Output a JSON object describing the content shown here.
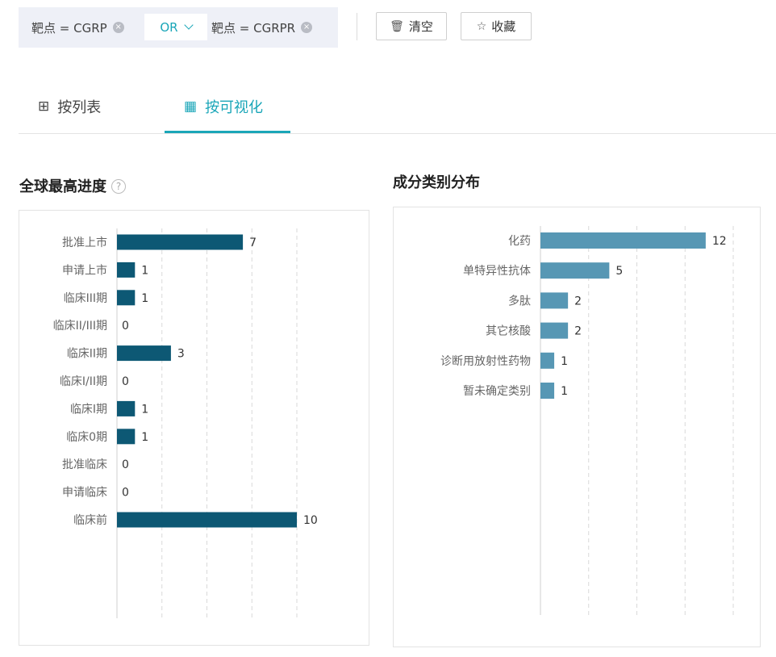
{
  "filters": {
    "chip1": "靶点 = CGRP",
    "operator": "OR",
    "chip2": "靶点 = CGRPR",
    "close_glyph": "×"
  },
  "toolbar": {
    "clear_label": "清空",
    "collect_label": "收藏"
  },
  "tabs": {
    "list_label": "按列表",
    "visual_label": "按可视化",
    "active": "visual"
  },
  "sections": {
    "progress_title": "全球最高进度",
    "help_glyph": "?",
    "category_title": "成分类别分布"
  },
  "colors": {
    "accent": "#1aa6b8",
    "bar_dark": "#0d5874",
    "bar_light": "#5797b4"
  },
  "chart_data": [
    {
      "type": "bar",
      "orientation": "horizontal",
      "categories": [
        "批准上市",
        "申请上市",
        "临床III期",
        "临床II/III期",
        "临床II期",
        "临床I/II期",
        "临床I期",
        "临床0期",
        "批准临床",
        "申请临床",
        "临床前"
      ],
      "values": [
        7,
        1,
        1,
        0,
        3,
        0,
        1,
        1,
        0,
        0,
        10
      ],
      "xlim": [
        0,
        10
      ],
      "grid": true,
      "legend": "none"
    },
    {
      "type": "bar",
      "orientation": "horizontal",
      "categories": [
        "化药",
        "单特异性抗体",
        "多肽",
        "其它核酸",
        "诊断用放射性药物",
        "暂未确定类别"
      ],
      "values": [
        12,
        5,
        2,
        2,
        1,
        1
      ],
      "xlim": [
        0,
        14
      ],
      "grid": true,
      "legend": "none"
    }
  ]
}
